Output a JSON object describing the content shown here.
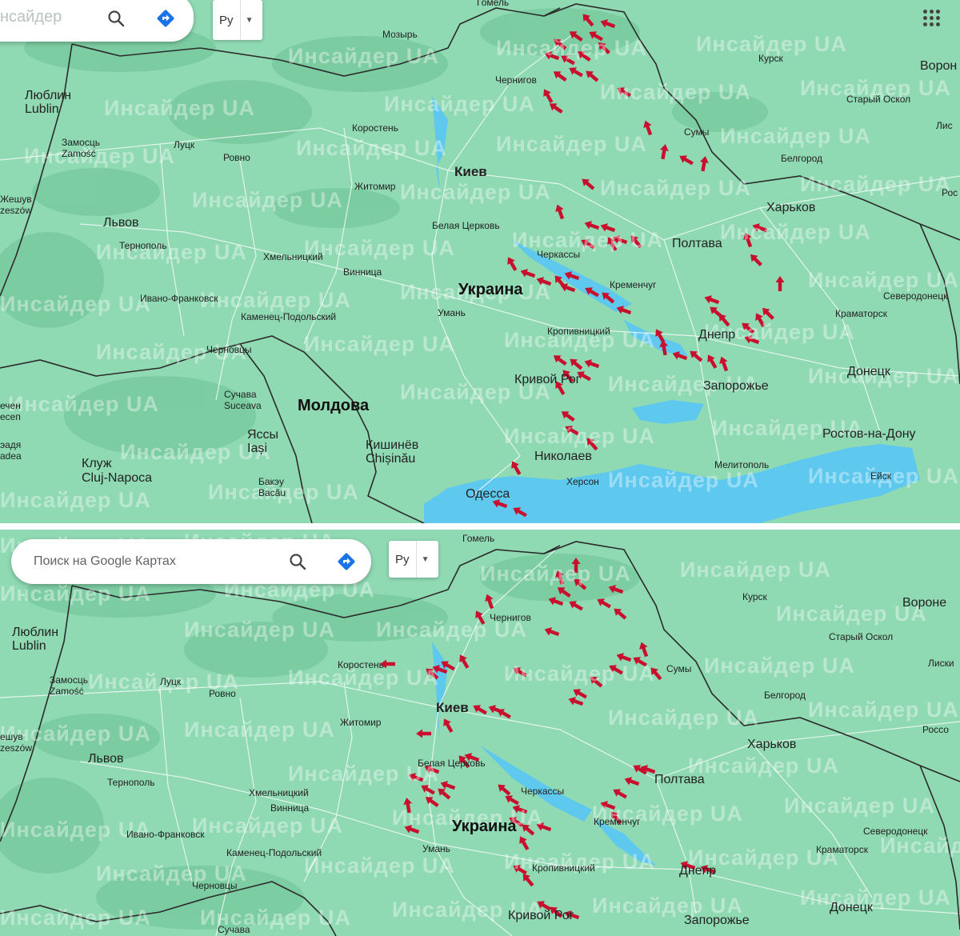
{
  "watermark": "Инсайдер UA",
  "colors": {
    "land": "#8fd9b3",
    "water": "#5ec8ee",
    "border": "#2b2b2b",
    "road": "#ffffff",
    "arrow": "#c8102e",
    "forest": "#78c99e"
  },
  "top_panel": {
    "search_text": "нсайдер",
    "search_icon": "search-icon",
    "directions_icon": "directions-icon",
    "language": "Ру",
    "apps_icon": "apps-grid-icon",
    "labels": [
      {
        "id": "gomel",
        "text": "Гомель"
      },
      {
        "id": "mozyr",
        "text": "Мозырь"
      },
      {
        "id": "kursk",
        "text": "Курск"
      },
      {
        "id": "voronezh",
        "text": "Ворон"
      },
      {
        "id": "lublin",
        "text": "Люблин\nLublin"
      },
      {
        "id": "chernigov",
        "text": "Чернигов"
      },
      {
        "id": "stary_oskol",
        "text": "Старый Оскол"
      },
      {
        "id": "zamosc",
        "text": "Замосць\nZamość"
      },
      {
        "id": "korosten",
        "text": "Коростень"
      },
      {
        "id": "sumy",
        "text": "Сумы"
      },
      {
        "id": "lisichansk",
        "text": "Лис"
      },
      {
        "id": "lutsk",
        "text": "Луцк"
      },
      {
        "id": "rovno",
        "text": "Ровно"
      },
      {
        "id": "belgorod",
        "text": "Белгород"
      },
      {
        "id": "kiev",
        "text": "Киев"
      },
      {
        "id": "zhitomir",
        "text": "Житомир"
      },
      {
        "id": "rzeszow",
        "text": "Жешув\nzeszów"
      },
      {
        "id": "ros",
        "text": "Рос"
      },
      {
        "id": "harkov",
        "text": "Харьков"
      },
      {
        "id": "lvov",
        "text": "Львов"
      },
      {
        "id": "belaya_cerkov",
        "text": "Белая Церковь"
      },
      {
        "id": "ternopol",
        "text": "Тернополь"
      },
      {
        "id": "poltava",
        "text": "Полтава"
      },
      {
        "id": "hmelnitskiy",
        "text": "Хмельницкий"
      },
      {
        "id": "cherkassy",
        "text": "Черкассы"
      },
      {
        "id": "vinnitsa",
        "text": "Винница"
      },
      {
        "id": "ukraina",
        "text": "Украина"
      },
      {
        "id": "kremenchug",
        "text": "Кременчуг"
      },
      {
        "id": "ivano_frankovsk",
        "text": "Ивано-Франковск"
      },
      {
        "id": "severodonetsk",
        "text": "Северодонецк"
      },
      {
        "id": "uman",
        "text": "Умань"
      },
      {
        "id": "kramatorsk",
        "text": "Краматорск"
      },
      {
        "id": "kamenets",
        "text": "Каменец-Подольский"
      },
      {
        "id": "kropivnitskiy",
        "text": "Кропивницкий"
      },
      {
        "id": "dnepr",
        "text": "Днепр"
      },
      {
        "id": "chernovtsy",
        "text": "Черновцы"
      },
      {
        "id": "donetsk",
        "text": "Донецк"
      },
      {
        "id": "krivoy_rog",
        "text": "Кривой Рог"
      },
      {
        "id": "zaporozhye",
        "text": "Запорожье"
      },
      {
        "id": "suceava",
        "text": "Сучава\nSuceava"
      },
      {
        "id": "moldova",
        "text": "Молдова"
      },
      {
        "id": "suceni",
        "text": "ечен\nесеп"
      },
      {
        "id": "iasi",
        "text": "Яссы\nIași"
      },
      {
        "id": "chisinau",
        "text": "Кишинёв\nChișinău"
      },
      {
        "id": "rostov",
        "text": "Ростов-на-Дону"
      },
      {
        "id": "radauti",
        "text": "эадя\nadea"
      },
      {
        "id": "cluj",
        "text": "Клуж\nCluj-Napoca"
      },
      {
        "id": "nikolaev",
        "text": "Николаев"
      },
      {
        "id": "melitopol",
        "text": "Мелитополь"
      },
      {
        "id": "bacau",
        "text": "Бакэу\nBacău"
      },
      {
        "id": "herson",
        "text": "Херсон"
      },
      {
        "id": "eysk",
        "text": "Ейск"
      },
      {
        "id": "odessa",
        "text": "Одесса"
      }
    ]
  },
  "bottom_panel": {
    "search_placeholder": "Поиск на Google Картах",
    "search_icon": "search-icon",
    "directions_icon": "directions-icon",
    "language": "Ру",
    "labels": [
      {
        "id": "gomel",
        "text": "Гомель"
      },
      {
        "id": "kursk",
        "text": "Курск"
      },
      {
        "id": "voronezh",
        "text": "Вороне"
      },
      {
        "id": "lublin",
        "text": "Люблин\nLublin"
      },
      {
        "id": "chernigov",
        "text": "Чернигов"
      },
      {
        "id": "stary_oskol",
        "text": "Старый Оскол"
      },
      {
        "id": "korosten",
        "text": "Коростень"
      },
      {
        "id": "sumy",
        "text": "Сумы"
      },
      {
        "id": "lisichansk",
        "text": "Лиски"
      },
      {
        "id": "zamosc",
        "text": "Замосць\nZamość"
      },
      {
        "id": "lutsk",
        "text": "Луцк"
      },
      {
        "id": "rovno",
        "text": "Ровно"
      },
      {
        "id": "belgorod",
        "text": "Белгород"
      },
      {
        "id": "kiev",
        "text": "Киев"
      },
      {
        "id": "zhitomir",
        "text": "Житомир"
      },
      {
        "id": "rzeszow",
        "text": "ешув\nzeszów"
      },
      {
        "id": "rossosh",
        "text": "Россо"
      },
      {
        "id": "harkov",
        "text": "Харьков"
      },
      {
        "id": "lvov",
        "text": "Львов"
      },
      {
        "id": "belaya_cerkov",
        "text": "Белая Церковь"
      },
      {
        "id": "ternopol",
        "text": "Тернополь"
      },
      {
        "id": "poltava",
        "text": "Полтава"
      },
      {
        "id": "hmelnitskiy",
        "text": "Хмельницкий"
      },
      {
        "id": "cherkassy",
        "text": "Черкассы"
      },
      {
        "id": "vinnitsa",
        "text": "Винница"
      },
      {
        "id": "ukraina",
        "text": "Украина"
      },
      {
        "id": "kremenchug",
        "text": "Кременчуг"
      },
      {
        "id": "ivano_frankovsk",
        "text": "Ивано-Франковск"
      },
      {
        "id": "severodonetsk",
        "text": "Северодонецк"
      },
      {
        "id": "uman",
        "text": "Умань"
      },
      {
        "id": "kamenets",
        "text": "Каменец-Подольский"
      },
      {
        "id": "kramatorsk",
        "text": "Краматорск"
      },
      {
        "id": "kropivnitskiy",
        "text": "Кропивницкий"
      },
      {
        "id": "dnepr",
        "text": "Днепр"
      },
      {
        "id": "chernovtsy",
        "text": "Черновцы"
      },
      {
        "id": "donetsk",
        "text": "Донецк"
      },
      {
        "id": "krivoy_rog",
        "text": "Кривой Рог"
      },
      {
        "id": "zaporozhye",
        "text": "Запорожье"
      },
      {
        "id": "suceava",
        "text": "Сучава"
      }
    ]
  }
}
